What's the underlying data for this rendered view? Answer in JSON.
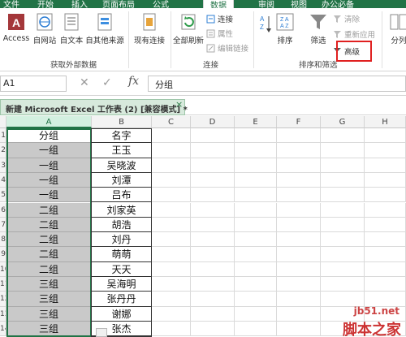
{
  "tabs": [
    "文件",
    "开始",
    "插入",
    "页面布局",
    "公式",
    "数据",
    "审阅",
    "视图",
    "办公必备"
  ],
  "active_tab": "数据",
  "ribbon": {
    "get_external": {
      "access": "Access",
      "web": "自网站",
      "text": "自文本",
      "other": "自其他来源",
      "existing": "现有连接",
      "label": "获取外部数据"
    },
    "connections": {
      "refresh_all": "全部刷新",
      "connections": "连接",
      "properties": "属性",
      "edit_links": "编辑链接",
      "label": "连接"
    },
    "sort_filter": {
      "sort": "排序",
      "filter": "筛选",
      "clear": "清除",
      "reapply": "重新应用",
      "advanced": "高级",
      "label": "排序和筛选"
    },
    "split": "分列"
  },
  "formula_bar": {
    "name_box": "A1",
    "fx": "fx",
    "value": "分组"
  },
  "workbook_title": "新建 Microsoft Excel 工作表 (2)  [兼容模式] *",
  "columns": [
    "A",
    "B",
    "C",
    "D",
    "E",
    "F",
    "G",
    "H"
  ],
  "row_numbers": [
    "1",
    "2",
    "3",
    "4",
    "5",
    "6",
    "7",
    "8",
    "9",
    "10",
    "11",
    "12",
    "13",
    "14"
  ],
  "rows": [
    {
      "a": "分组",
      "b": "名字"
    },
    {
      "a": "一组",
      "b": "王玉"
    },
    {
      "a": "一组",
      "b": "吴晓波"
    },
    {
      "a": "一组",
      "b": "刘潭"
    },
    {
      "a": "一组",
      "b": "吕布"
    },
    {
      "a": "二组",
      "b": "刘家英"
    },
    {
      "a": "二组",
      "b": "胡浩"
    },
    {
      "a": "二组",
      "b": "刘丹"
    },
    {
      "a": "二组",
      "b": "萌萌"
    },
    {
      "a": "二组",
      "b": "天天"
    },
    {
      "a": "三组",
      "b": "吴海明"
    },
    {
      "a": "三组",
      "b": "张丹丹"
    },
    {
      "a": "三组",
      "b": "谢娜"
    },
    {
      "a": "三组",
      "b": "张杰"
    }
  ],
  "watermark": {
    "site": "jb51.net",
    "name": "脚本之家"
  },
  "colors": {
    "excel_green": "#217346",
    "highlight_red": "#e02020"
  }
}
